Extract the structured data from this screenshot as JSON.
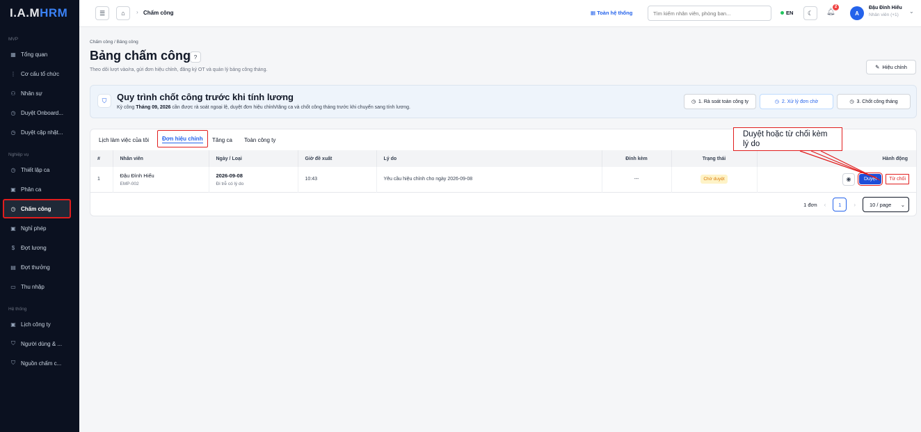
{
  "brand": {
    "logo_a": "I.A.M",
    "logo_b": "HRM"
  },
  "sidebar": {
    "sections": [
      {
        "title": "MVP",
        "items": [
          {
            "label": "Tổng quan",
            "icon": "building-icon"
          },
          {
            "label": "Cơ cấu tổ chức",
            "icon": "tree-icon"
          },
          {
            "label": "Nhân sự",
            "icon": "users-icon"
          },
          {
            "label": "Duyệt Onboard...",
            "icon": "clock-icon"
          },
          {
            "label": "Duyệt cập nhật...",
            "icon": "clock-icon"
          }
        ]
      },
      {
        "title": "Nghiệp vụ",
        "items": [
          {
            "label": "Thiết lập ca",
            "icon": "clock-icon"
          },
          {
            "label": "Phân ca",
            "icon": "calendar-icon"
          },
          {
            "label": "Chấm công",
            "icon": "clock-icon",
            "active": true
          },
          {
            "label": "Nghỉ phép",
            "icon": "calendar-icon"
          },
          {
            "label": "Đợt lương",
            "icon": "dollar-icon"
          },
          {
            "label": "Đợt thưởng",
            "icon": "receipt-icon"
          },
          {
            "label": "Thu nhập",
            "icon": "wallet-icon"
          }
        ]
      },
      {
        "title": "Hệ thống",
        "items": [
          {
            "label": "Lịch công ty",
            "icon": "calendar-icon"
          },
          {
            "label": "Người dùng & ...",
            "icon": "shield-icon"
          },
          {
            "label": "Nguồn chấm c...",
            "icon": "shield-icon"
          }
        ]
      }
    ]
  },
  "topbar": {
    "breadcrumb": "Chấm công",
    "system_link": "Toàn hệ thống",
    "search_placeholder": "Tìm kiếm nhân viên, phòng ban...",
    "lang": "EN",
    "notif_count": "2",
    "avatar_initial": "A",
    "user_name": "Đậu Đình Hiếu",
    "user_role": "Nhân viên (+1)"
  },
  "page": {
    "breadcrumb": "Chấm công / Bảng công",
    "title": "Bảng chấm công",
    "subtitle": "Theo dõi lượt vào/ra, gửi đơn hiệu chỉnh, đăng ký OT và quản lý bảng công tháng.",
    "edit_label": "Hiệu chỉnh"
  },
  "process": {
    "title": "Quy trình chốt công trước khi tính lương",
    "desc_prefix": "Kỳ công ",
    "desc_period": "Tháng 09, 2026",
    "desc_suffix": " cần được rà soát ngoại lệ, duyệt đơn hiệu chỉnh/tăng ca và chốt công tháng trước khi chuyển sang tính lương.",
    "steps": [
      "1. Rà soát toàn công ty",
      "2. Xử lý đơn chờ",
      "3. Chốt công tháng"
    ]
  },
  "tabs": [
    "Lịch làm việc của tôi",
    "Đơn hiệu chỉnh",
    "Tăng ca",
    "Toàn công ty"
  ],
  "table": {
    "headers": [
      "#",
      "Nhân viên",
      "Ngày / Loại",
      "Giờ đề xuất",
      "Lý do",
      "Đính kèm",
      "Trạng thái",
      "Hành động"
    ],
    "rows": [
      {
        "no": "1",
        "name": "Đậu Đình Hiếu",
        "code": "EMP-002",
        "date": "2026-09-08",
        "type": "Đi trễ có lý do",
        "time": "10:43",
        "reason": "Yêu cầu hiệu chỉnh cho ngày 2026-09-08",
        "attach": "---",
        "status": "Chờ duyệt",
        "approve": "Duyệt",
        "reject": "Từ chối"
      }
    ]
  },
  "pagination": {
    "total": "1 đơn",
    "page": "1",
    "page_size": "10 / page"
  },
  "annotation": {
    "text": "Duyệt hoặc từ chối kèm lý do"
  },
  "colors": {
    "accent": "#2563eb",
    "annotation": "#e11d1d",
    "sidebar_bg": "#0b1120",
    "status_pending": "#d97706"
  }
}
